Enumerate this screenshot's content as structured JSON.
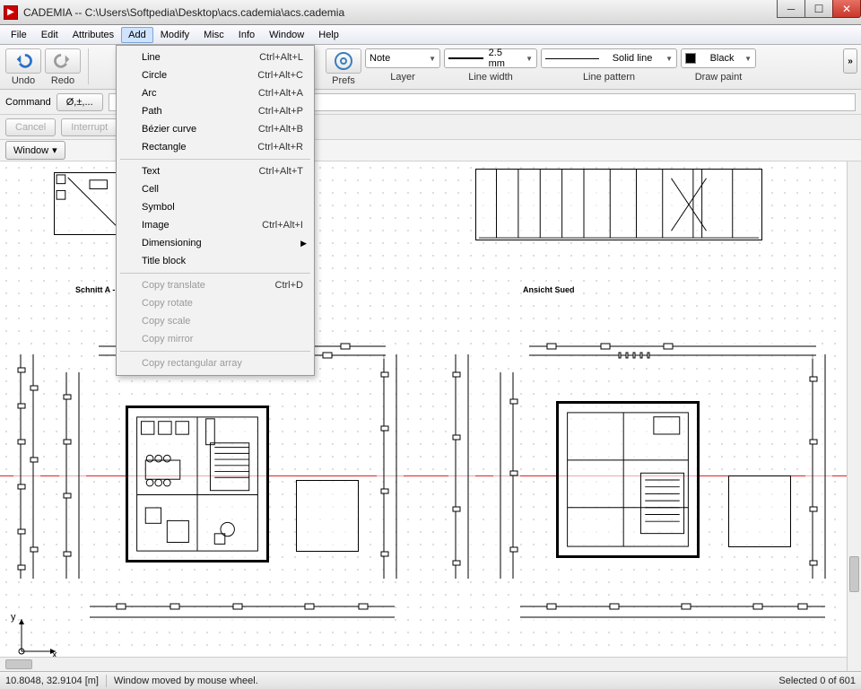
{
  "titlebar": {
    "text": "CADEMIA -- C:\\Users\\Softpedia\\Desktop\\acs.cademia\\acs.cademia"
  },
  "menubar": [
    "File",
    "Edit",
    "Attributes",
    "Add",
    "Modify",
    "Misc",
    "Info",
    "Window",
    "Help"
  ],
  "menubar_active_index": 3,
  "dropdown": {
    "groups": [
      [
        {
          "label": "Line",
          "shortcut": "Ctrl+Alt+L"
        },
        {
          "label": "Circle",
          "shortcut": "Ctrl+Alt+C"
        },
        {
          "label": "Arc",
          "shortcut": "Ctrl+Alt+A"
        },
        {
          "label": "Path",
          "shortcut": "Ctrl+Alt+P"
        },
        {
          "label": "Bézier curve",
          "shortcut": "Ctrl+Alt+B"
        },
        {
          "label": "Rectangle",
          "shortcut": "Ctrl+Alt+R"
        }
      ],
      [
        {
          "label": "Text",
          "shortcut": "Ctrl+Alt+T"
        },
        {
          "label": "Cell",
          "shortcut": ""
        },
        {
          "label": "Symbol",
          "shortcut": ""
        },
        {
          "label": "Image",
          "shortcut": "Ctrl+Alt+I"
        },
        {
          "label": "Dimensioning",
          "shortcut": "",
          "submenu": true
        },
        {
          "label": "Title block",
          "shortcut": ""
        }
      ],
      [
        {
          "label": "Copy translate",
          "shortcut": "Ctrl+D",
          "disabled": true
        },
        {
          "label": "Copy rotate",
          "shortcut": "",
          "disabled": true
        },
        {
          "label": "Copy scale",
          "shortcut": "",
          "disabled": true
        },
        {
          "label": "Copy mirror",
          "shortcut": "",
          "disabled": true
        }
      ],
      [
        {
          "label": "Copy rectangular array",
          "shortcut": "",
          "disabled": true
        }
      ]
    ]
  },
  "toolbar": {
    "undo": "Undo",
    "redo": "Redo",
    "prefs": "Prefs",
    "layer_label": "Layer",
    "layer_value": "Note",
    "linewidth_label": "Line width",
    "linewidth_value": "2.5 mm",
    "linepattern_label": "Line pattern",
    "linepattern_value": "Solid line",
    "drawpaint_label": "Draw paint",
    "drawpaint_value": "Black"
  },
  "cmd": {
    "label": "Command",
    "symbolbtn": "Ø,±,...",
    "cancel": "Cancel",
    "interrupt": "Interrupt",
    "window": "Window"
  },
  "canvas": {
    "label_left": "Schnitt A - A",
    "label_right": "Ansicht Sued",
    "axis_x": "x",
    "axis_y": "y"
  },
  "status": {
    "coords": "10.8048, 32.9104 [m]",
    "message": "Window moved by mouse wheel.",
    "selected": "Selected 0 of 601"
  }
}
